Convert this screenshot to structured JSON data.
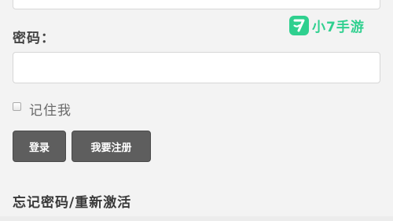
{
  "form": {
    "password_label": "密码：",
    "password_value": "",
    "remember_label": "记住我",
    "login_button": "登录",
    "register_button": "我要注册",
    "forgot_link": "忘记密码/重新激活"
  },
  "watermark": {
    "text": "小7手游",
    "color": "#2fd08f"
  }
}
